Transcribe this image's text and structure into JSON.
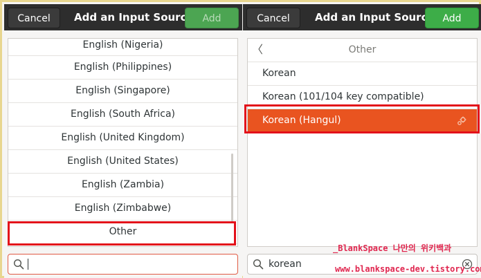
{
  "left_dialog": {
    "cancel_label": "Cancel",
    "title": "Add an Input Source",
    "add_label": "Add",
    "languages": [
      "English (Nigeria)",
      "English (Philippines)",
      "English (Singapore)",
      "English (South Africa)",
      "English (United Kingdom)",
      "English (United States)",
      "English (Zambia)",
      "English (Zimbabwe)",
      "Other"
    ],
    "search": {
      "value": ""
    }
  },
  "right_dialog": {
    "cancel_label": "Cancel",
    "title": "Add an Input Source",
    "add_label": "Add",
    "section_header": "Other",
    "variants": [
      "Korean",
      "Korean (101/104 key compatible)",
      "Korean (Hangul)"
    ],
    "selected_index": 2,
    "search": {
      "value": "korean"
    }
  },
  "watermark": {
    "line1": "_BlankSpace 나만의 위키백과",
    "line2": "www.blankspace-dev.tistory.com"
  },
  "colors": {
    "headerbar": "#2d2d2d",
    "add_button": "#3dad48",
    "selection": "#e95420",
    "highlight_box": "#e3101a",
    "watermark": "#e0264f"
  },
  "icons": {
    "back": "chevron-left-icon",
    "settings": "gear-icon",
    "search": "search-icon",
    "clear": "clear-icon"
  }
}
